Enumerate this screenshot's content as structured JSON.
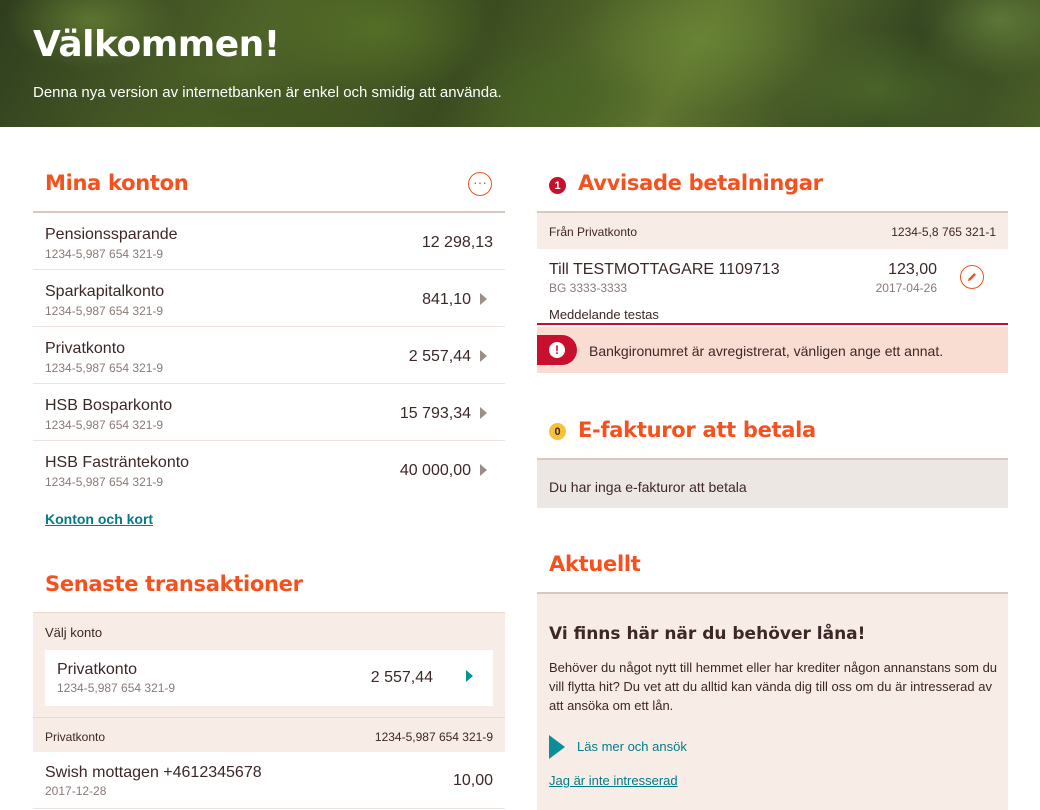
{
  "hero": {
    "title": "Välkommen!",
    "subtitle": "Denna nya version av internetbanken är enkel och smidig att använda."
  },
  "my_accounts": {
    "title": "Mina konton",
    "more_icon": "ellipsis-icon",
    "accounts": [
      {
        "name": "Pensionssparande",
        "number": "1234-5,987 654 321-9",
        "balance": "12 298,13",
        "has_arrow": false
      },
      {
        "name": "Sparkapitalkonto",
        "number": "1234-5,987 654 321-9",
        "balance": "841,10",
        "has_arrow": true
      },
      {
        "name": "Privatkonto",
        "number": "1234-5,987 654 321-9",
        "balance": "2 557,44",
        "has_arrow": true
      },
      {
        "name": "HSB Bosparkonto",
        "number": "1234-5,987 654 321-9",
        "balance": "15 793,34",
        "has_arrow": true
      },
      {
        "name": "HSB Fasträntekonto",
        "number": "1234-5,987 654 321-9",
        "balance": "40 000,00",
        "has_arrow": true
      }
    ],
    "link": "Konton och kort"
  },
  "transactions": {
    "title": "Senaste transaktioner",
    "select_label": "Välj konto",
    "selected": {
      "name": "Privatkonto",
      "number": "1234-5,987 654 321-9",
      "balance": "2 557,44"
    },
    "list_account": "Privatkonto",
    "list_number": "1234-5,987 654 321-9",
    "items": [
      {
        "name": "Swish mottagen +4612345678",
        "date": "2017-12-28",
        "amount": "10,00"
      }
    ]
  },
  "rejected": {
    "count": "1",
    "title": "Avvisade betalningar",
    "from_label": "Från Privatkonto",
    "from_number": "1234-5,8 765 321-1",
    "to": "Till TESTMOTTAGARE 1109713",
    "bg": "BG 3333-3333",
    "amount": "123,00",
    "date": "2017-04-26",
    "message": "Meddelande testas",
    "error": "Bankgironumret är avregistrerat, vänligen ange ett annat.",
    "edit_icon": "pencil-icon"
  },
  "einvoices": {
    "count": "0",
    "title": "E-fakturor att betala",
    "empty": "Du har inga e-fakturor att betala"
  },
  "news": {
    "title": "Aktuellt",
    "headline": "Vi finns här när du behöver låna!",
    "body": "Behöver du något nytt till hemmet eller har krediter någon annanstans som du vill flytta hit? Du vet att du alltid kan vända dig till oss om du är intresserad av att ansöka om ett lån.",
    "cta": "Läs mer och ansök",
    "decline": "Jag är inte intresserad"
  },
  "colors": {
    "accent": "#f4511e",
    "error": "#c8102e",
    "teal": "#007c8a",
    "warning": "#f5c23a"
  }
}
